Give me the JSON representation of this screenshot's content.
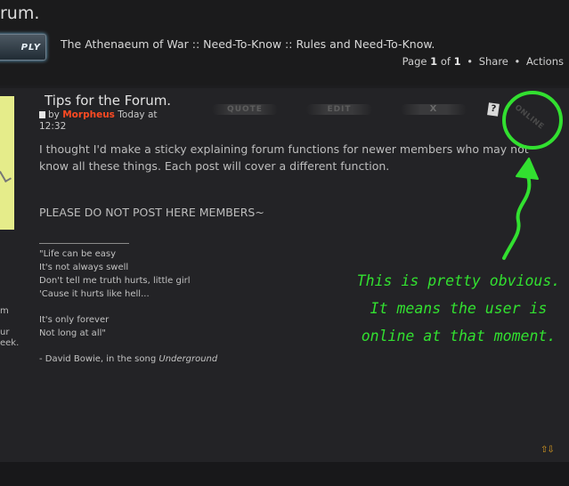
{
  "header": {
    "page_heading": "rum.",
    "reply_label": "PLY",
    "breadcrumb": "The Athenaeum of War :: Need-To-Know :: Rules and Need-To-Know.",
    "pagination": {
      "prefix": "Page",
      "current": "1",
      "of": "of",
      "total": "1"
    },
    "share_label": "Share",
    "actions_label": "Actions"
  },
  "post": {
    "title": "Tips for the Forum.",
    "by": "by",
    "author": "Morpheus",
    "posted": "Today at",
    "time": "12:32",
    "buttons": {
      "quote": "QUOTE",
      "edit": "EDIT",
      "delete": "X",
      "report": "?",
      "online": "ONLINE"
    },
    "body": "I thought I'd make a sticky explaining forum functions for newer members who may not know all these things. Each post will cover a different function.",
    "warning": "PLEASE DO NOT POST HERE MEMBERS~",
    "signature": {
      "lines_a": [
        "\"Life can be easy",
        "It's not always swell",
        "Don't tell me truth hurts, little girl",
        "'Cause it hurts like hell..."
      ],
      "lines_b": [
        "It's only forever",
        "Not long at all\""
      ],
      "credit_prefix": "- David Bowie, in the song",
      "credit_song": "Underground"
    },
    "side_fragments": [
      "m",
      "ur",
      "eek."
    ]
  },
  "annotation": {
    "lines": [
      "This is pretty obvious.",
      "It means the user is",
      "online at that moment."
    ],
    "color": "#32e030"
  },
  "scroll_arrows": "⇧⇩"
}
